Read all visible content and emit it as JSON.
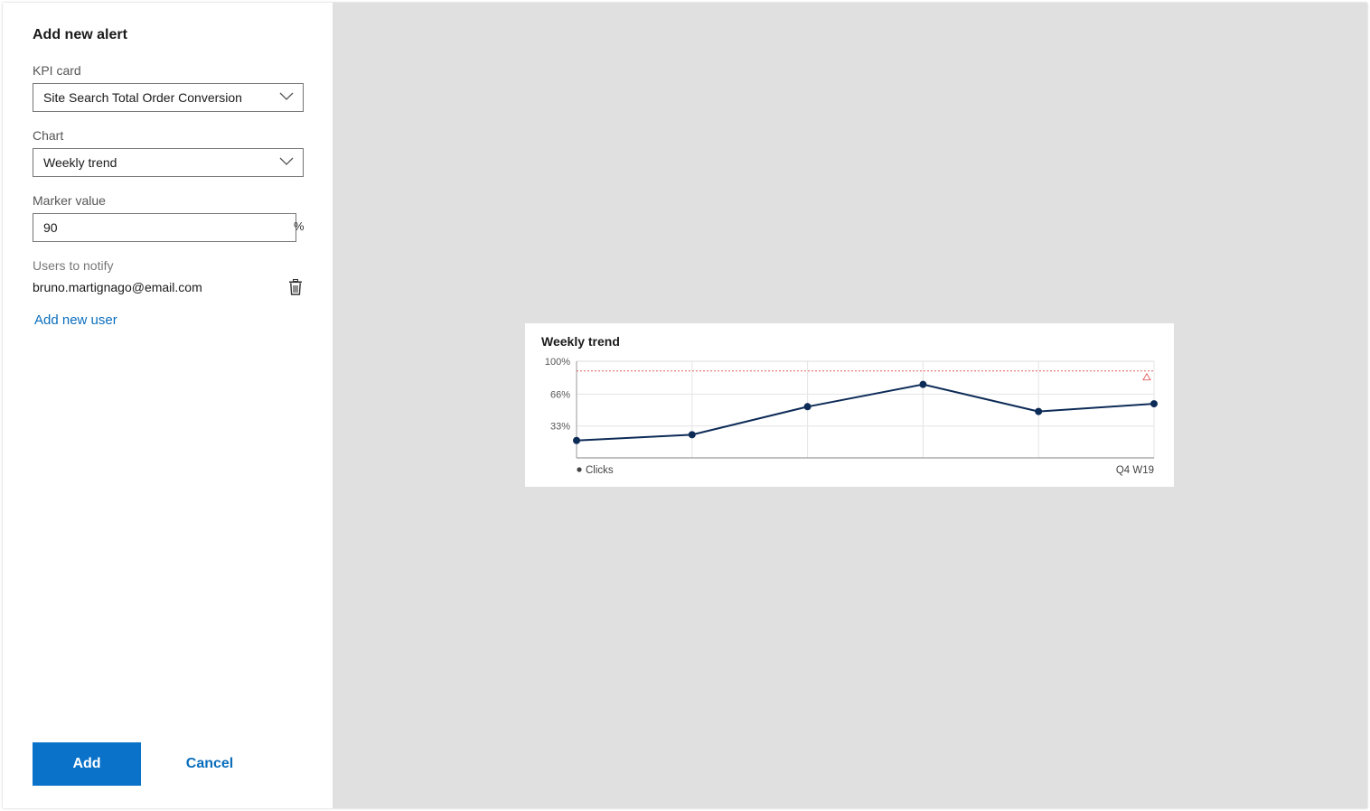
{
  "panel": {
    "title": "Add new alert",
    "kpi_label": "KPI card",
    "kpi_value": "Site Search Total Order Conversion",
    "chart_label": "Chart",
    "chart_value": "Weekly trend",
    "marker_label": "Marker value",
    "marker_value": "90",
    "marker_unit": "%",
    "users_label": "Users to notify",
    "users": [
      "bruno.martignago@email.com"
    ],
    "add_user": "Add new user",
    "add_button": "Add",
    "cancel_button": "Cancel"
  },
  "icons": {
    "kpi_dropdown": "chevron-down-icon",
    "chart_dropdown": "chevron-down-icon",
    "delete_user": "trash-icon",
    "marker_warning": "warning-icon"
  },
  "colors": {
    "primary": "#0a72c9",
    "link": "#0a6ebd",
    "series_line": "#0d2b57",
    "marker_line": "#e05a5a",
    "backdrop": "#e0e0e0"
  },
  "chart_data": {
    "type": "line",
    "title": "Weekly trend",
    "series": [
      {
        "name": "Clicks",
        "values": [
          18,
          24,
          53,
          76,
          48,
          56
        ]
      }
    ],
    "y_ticks": [
      "100%",
      "66%",
      "33%"
    ],
    "ylim": [
      0,
      100
    ],
    "marker_value": 90,
    "x_label_end": "Q4 W19",
    "grid": true,
    "legend": "bottom-left"
  }
}
